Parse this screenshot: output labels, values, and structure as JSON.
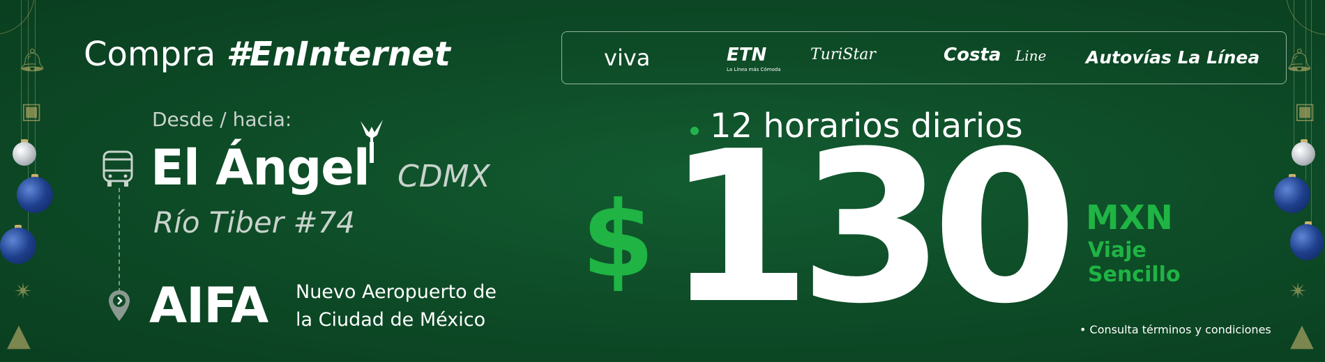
{
  "headline": {
    "prefix": "Compra",
    "hashtag": "#EnInternet"
  },
  "origin": {
    "label": "Desde / hacia:",
    "name": "El Ángel",
    "city": "CDMX",
    "address": "Río Tiber #74"
  },
  "destination": {
    "name": "AIFA",
    "description_line1": "Nuevo Aeropuerto de",
    "description_line2": "la Ciudad de México"
  },
  "logos": {
    "viva": "viva",
    "etn": "ETN",
    "etn_sub": "La Línea más Cómoda",
    "turistar": "TuriStar",
    "costa": "Costa",
    "costa_line": "Line",
    "autovias": "Autovías La Línea"
  },
  "offer": {
    "schedules": "12 horarios diarios",
    "currency_symbol": "$",
    "price": "130",
    "currency": "MXN",
    "trip_line1": "Viaje",
    "trip_line2": "Sencillo",
    "terms": "• Consulta términos y condiciones"
  },
  "colors": {
    "background": "#0d4a26",
    "accent_green": "#1fb444",
    "text_white": "#ffffff",
    "text_muted": "#c9d3cc"
  }
}
